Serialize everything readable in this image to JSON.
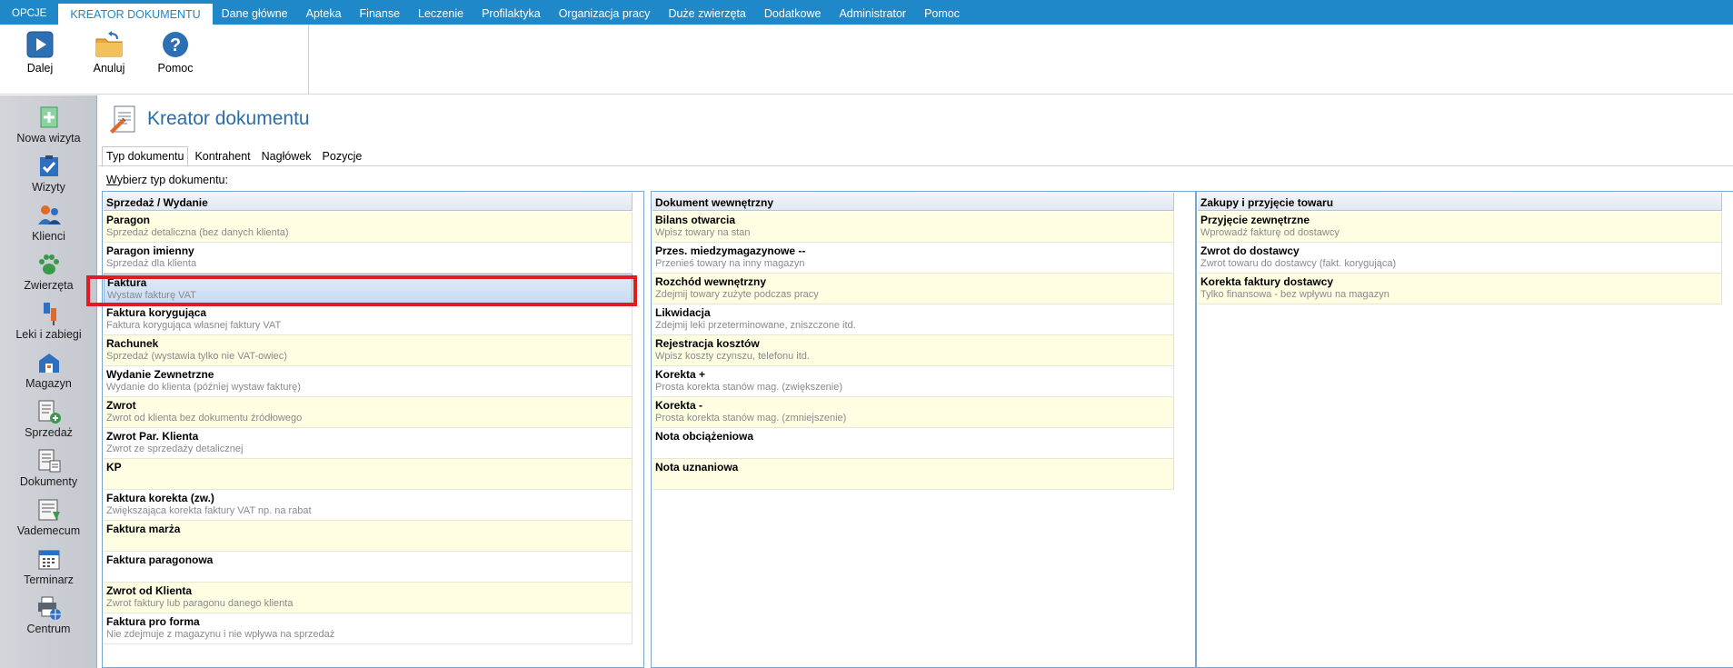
{
  "menu": {
    "items": [
      "OPCJE",
      "KREATOR DOKUMENTU",
      "Dane główne",
      "Apteka",
      "Finanse",
      "Leczenie",
      "Profilaktyka",
      "Organizacja pracy",
      "Duże zwierzęta",
      "Dodatkowe",
      "Administrator",
      "Pomoc"
    ],
    "active": "KREATOR DOKUMENTU"
  },
  "ribbon": {
    "next_label": "Dalej",
    "cancel_label": "Anuluj",
    "help_label": "Pomoc"
  },
  "sidebar": {
    "items": [
      {
        "label": "Nowa wizyta",
        "icon": "plus-document-icon"
      },
      {
        "label": "Wizyty",
        "icon": "clipboard-check-icon"
      },
      {
        "label": "Klienci",
        "icon": "people-icon"
      },
      {
        "label": "Zwierzęta",
        "icon": "paw-icon"
      },
      {
        "label": "Leki i zabiegi",
        "icon": "syringe-icon"
      },
      {
        "label": "Magazyn",
        "icon": "warehouse-icon"
      },
      {
        "label": "Sprzedaż",
        "icon": "receipt-plus-icon"
      },
      {
        "label": "Dokumenty",
        "icon": "documents-icon"
      },
      {
        "label": "Vademecum",
        "icon": "book-icon"
      },
      {
        "label": "Terminarz",
        "icon": "calendar-icon"
      },
      {
        "label": "Centrum",
        "icon": "printer-globe-icon"
      }
    ]
  },
  "page": {
    "title": "Kreator dokumentu",
    "tabs": [
      "Typ dokumentu",
      "Kontrahent",
      "Nagłówek",
      "Pozycje"
    ],
    "prompt_first": "W",
    "prompt_rest": "ybierz typ dokumentu:"
  },
  "panels": {
    "sales": {
      "header": "Sprzedaż / Wydanie",
      "rows": [
        {
          "title": "Paragon",
          "sub": "Sprzedaż detaliczna (bez danych klienta)"
        },
        {
          "title": "Paragon imienny",
          "sub": "Sprzedaż dla klienta"
        },
        {
          "title": "Faktura",
          "sub": "Wystaw fakturę VAT"
        },
        {
          "title": "Faktura korygująca",
          "sub": "Faktura korygująca własnej faktury VAT"
        },
        {
          "title": "Rachunek",
          "sub": "Sprzedaż (wystawia tylko nie VAT-owiec)"
        },
        {
          "title": "Wydanie Zewnetrzne",
          "sub": "Wydanie do klienta (później wystaw fakturę)"
        },
        {
          "title": "Zwrot",
          "sub": "Zwrot od klienta bez dokumentu źródłowego"
        },
        {
          "title": "Zwrot Par. Klienta",
          "sub": "Zwrot ze sprzedaży detalicznej"
        },
        {
          "title": "KP",
          "sub": ""
        },
        {
          "title": "Faktura korekta (zw.)",
          "sub": "Zwiększająca korekta faktury VAT np. na rabat"
        },
        {
          "title": "Faktura marża",
          "sub": ""
        },
        {
          "title": "Faktura paragonowa",
          "sub": ""
        },
        {
          "title": "Zwrot od  Klienta",
          "sub": "Zwrot faktury lub paragonu danego klienta"
        },
        {
          "title": "Faktura pro forma",
          "sub": "Nie zdejmuje z magazynu i nie wpływa na sprzedaż"
        }
      ]
    },
    "internal": {
      "header": "Dokument wewnętrzny",
      "rows": [
        {
          "title": "Bilans otwarcia",
          "sub": "Wpisz towary na stan"
        },
        {
          "title": "Przes. miedzymagazynowe --",
          "sub": "Przenieś towary na inny magazyn"
        },
        {
          "title": "Rozchód wewnętrzny",
          "sub": "Zdejmij towary zużyte podczas pracy"
        },
        {
          "title": "Likwidacja",
          "sub": "Zdejmij leki przeterminowane, zniszczone itd."
        },
        {
          "title": "Rejestracja kosztów",
          "sub": "Wpisz koszty czynszu, telefonu itd."
        },
        {
          "title": "Korekta +",
          "sub": "Prosta korekta stanów mag. (zwiększenie)"
        },
        {
          "title": "Korekta -",
          "sub": "Prosta korekta stanów mag. (zmniejszenie)"
        },
        {
          "title": "Nota obciążeniowa",
          "sub": ""
        },
        {
          "title": "Nota uznaniowa",
          "sub": ""
        }
      ]
    },
    "purchase": {
      "header": "Zakupy i przyjęcie towaru",
      "rows": [
        {
          "title": "Przyjęcie zewnętrzne",
          "sub": "Wprowadź fakturę od dostawcy"
        },
        {
          "title": "Zwrot do dostawcy",
          "sub": "Zwrot towaru do dostawcy (fakt. korygująca)"
        },
        {
          "title": "Korekta faktury dostawcy",
          "sub": "Tylko finansowa - bez wpływu na magazyn"
        }
      ]
    }
  },
  "colors": {
    "menubar": "#1e88c9",
    "odd_row": "#fffde2",
    "highlight": "#e01b24",
    "title": "#2a6ea8"
  }
}
